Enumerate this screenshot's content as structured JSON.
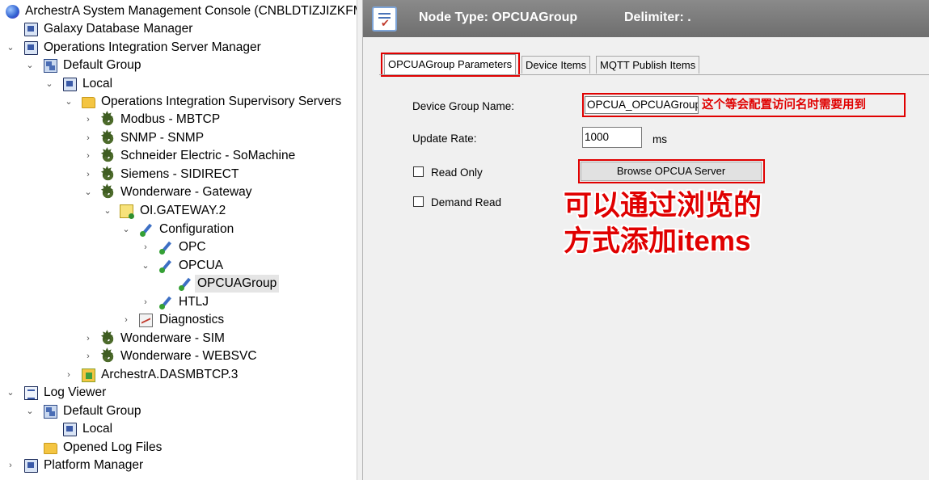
{
  "tree": {
    "root": "ArchestrA System Management Console (CNBLDTIZJIZKFMH",
    "galaxy_db": "Galaxy Database Manager",
    "oism": "Operations Integration Server Manager",
    "default_group": "Default Group",
    "local": "Local",
    "supervisory": "Operations Integration Supervisory Servers",
    "modbus": "Modbus - MBTCP",
    "snmp": "SNMP - SNMP",
    "schneider": "Schneider Electric - SoMachine",
    "siemens": "Siemens - SIDIRECT",
    "gateway": "Wonderware - Gateway",
    "oi_gateway": "OI.GATEWAY.2",
    "configuration": "Configuration",
    "opc": "OPC",
    "opcua": "OPCUA",
    "opcua_group": "OPCUAGroup",
    "htlj": "HTLJ",
    "diagnostics": "Diagnostics",
    "sim": "Wonderware - SIM",
    "websvc": "Wonderware - WEBSVC",
    "dasmbtcp": "ArchestrA.DASMBTCP.3",
    "log_viewer": "Log Viewer",
    "log_default_group": "Default Group",
    "log_local": "Local",
    "opened_log_files": "Opened Log Files",
    "platform_manager": "Platform Manager"
  },
  "header": {
    "node_type": "Node Type: OPCUAGroup",
    "delimiter": "Delimiter:  ."
  },
  "tabs": {
    "params": "OPCUAGroup Parameters",
    "device_items": "Device Items",
    "mqtt": "MQTT Publish Items"
  },
  "form": {
    "group_name_label": "Device Group Name:",
    "group_name_value": "OPCUA_OPCUAGroup",
    "update_rate_label": "Update Rate:",
    "update_rate_value": "1000",
    "update_rate_unit": "ms",
    "read_only_label": "Read Only",
    "demand_read_label": "Demand Read",
    "browse_button": "Browse OPCUA Server"
  },
  "annotations": {
    "access_name_note": "这个等会配置访问名时需要用到",
    "browse_note_line1": "可以通过浏览的",
    "browse_note_line2": "方式添加items"
  },
  "colors": {
    "annotation_red": "#e00000",
    "header_gray": "#7a7a7a"
  }
}
